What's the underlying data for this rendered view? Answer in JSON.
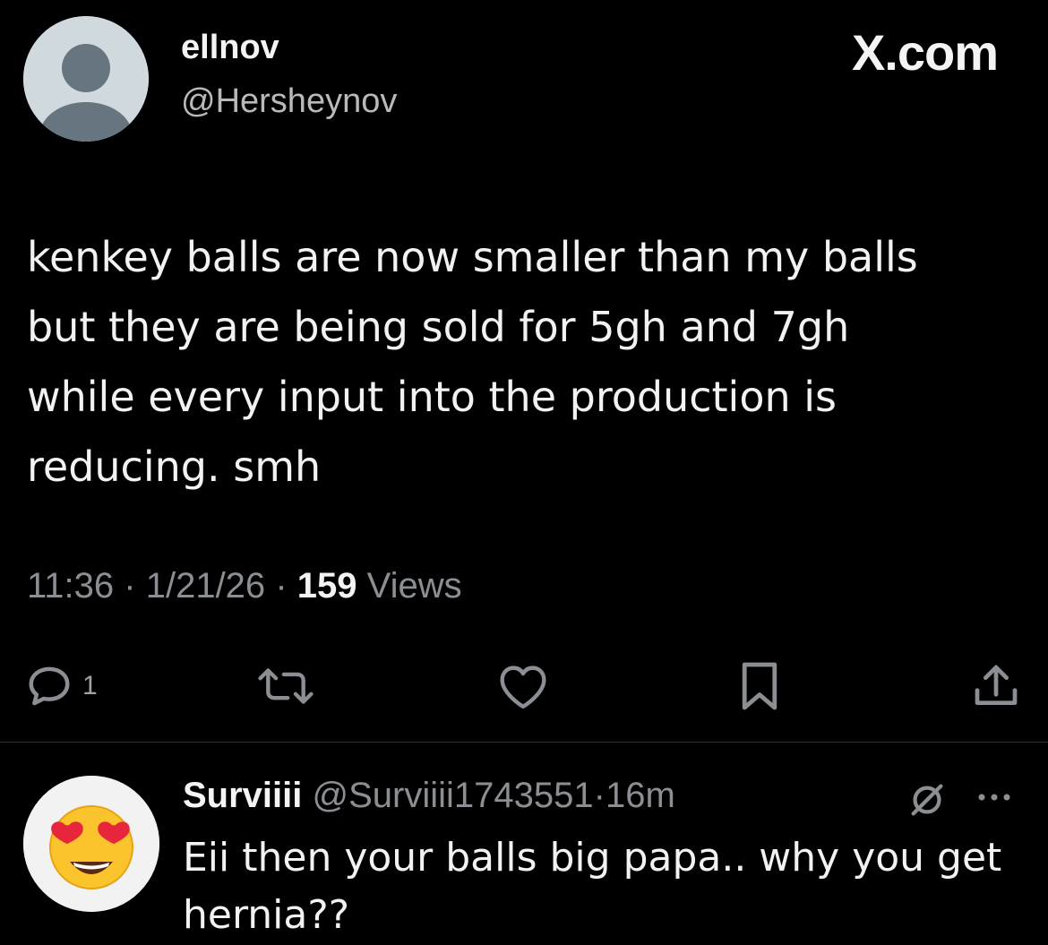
{
  "tweet": {
    "author_name": "ellnov",
    "author_handle": "@Hersheynov",
    "site_label": "X.com",
    "text": "kenkey balls are now smaller than my balls\nbut they are being sold for 5gh and 7gh\nwhile every input into the production is\nreducing. smh",
    "time": "11:36",
    "date": "1/21/26",
    "separator": "·",
    "views_count": "159",
    "views_label": "Views"
  },
  "actions": {
    "reply_count": "1",
    "reply_icon": "reply-icon",
    "retweet_icon": "retweet-icon",
    "like_icon": "heart-icon",
    "bookmark_icon": "bookmark-icon",
    "share_icon": "share-icon"
  },
  "reply": {
    "author_name": "Surviiii",
    "author_handle": "@Surviiii1743551",
    "separator": "·",
    "time": "16m",
    "text": "Eii then your balls big papa.. why you get\nhernia??",
    "avatar_emoji": "heart-eyes-emoji",
    "mute_icon": "mute-icon",
    "more_icon": "more-icon"
  },
  "colors": {
    "background": "#000000",
    "primary_text": "#e7e9ea",
    "secondary_text": "#8b8f94",
    "divider": "#2f3336",
    "avatar_bg": "#cfd9de"
  }
}
